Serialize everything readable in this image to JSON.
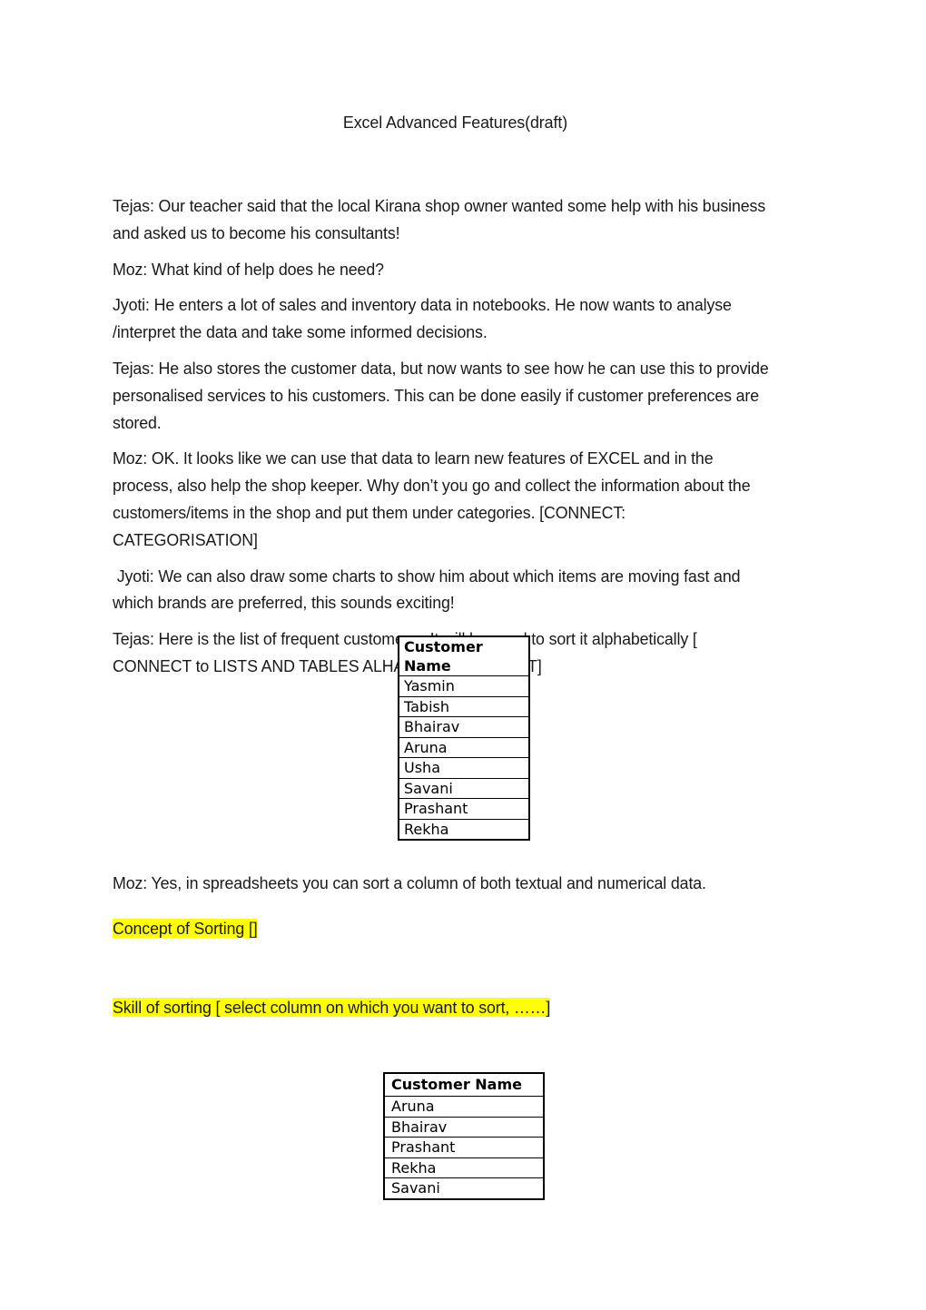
{
  "document": {
    "title": "Excel Advanced Features(draft)",
    "paragraphs": [
      {
        "id": "p-tejas-1",
        "speaker": "Tejas",
        "text": "Tejas: Our teacher said that the local Kirana shop owner wanted some help with his business and asked us to become his consultants!"
      },
      {
        "id": "p-moz-1",
        "speaker": "Moz",
        "text": "Moz: What kind of help does he need?"
      },
      {
        "id": "p-jyoti-1",
        "speaker": "Jyoti",
        "text": "Jyoti: He enters a lot of sales and inventory data in notebooks. He now wants to analyse /interpret the data and take some informed decisions."
      },
      {
        "id": "p-tejas-2",
        "speaker": "Tejas",
        "text": "Tejas: He also stores the customer data, but now wants to see how he can use this to provide personalised services to his customers. This can be done easily if customer preferences are stored."
      },
      {
        "id": "p-moz-2",
        "speaker": "Moz",
        "text": "Moz: OK. It looks like we can use that data to learn new features of EXCEL and in the process, also help the shop keeper. Why don’t you go and collect the information about the customers/items in the shop and put them under categories. [CONNECT: CATEGORISATION]"
      },
      {
        "id": "p-jyoti-2",
        "speaker": "Jyoti",
        "text": " Jyoti: We can also draw some charts to show him about which items are moving fast and which brands are preferred, this sounds exciting!"
      },
      {
        "id": "p-tejas-3",
        "speaker": "Tejas",
        "text": "Tejas: Here is the list of frequent customers.  It will be good to sort it alphabetically [ CONNECT to LISTS AND TABLES ALHABETICALLY SORT]"
      }
    ],
    "paragraph_after_table": {
      "id": "p-moz-3",
      "speaker": "Moz",
      "text": "Moz: Yes, in spreadsheets you can sort a column of both textual and numerical data."
    },
    "highlighted_lines": [
      {
        "id": "concept-of-sorting",
        "text": "Concept of Sorting []",
        "highlight_color": "#FFFF00"
      },
      {
        "id": "skill-of-sorting",
        "text": "Skill of sorting [ select column on which you want to sort, ……]",
        "highlight_color": "#FFFF00"
      }
    ],
    "tables": [
      {
        "id": "customer-unsorted",
        "header": "Customer Name",
        "rows": [
          "Yasmin",
          "Tabish",
          "Bhairav",
          "Aruna",
          "Usha",
          "Savani",
          "Prashant",
          "Rekha"
        ]
      },
      {
        "id": "customer-sorted",
        "header": "Customer Name",
        "rows": [
          "Aruna",
          "Bhairav",
          "Prashant",
          "Rekha",
          "Savani"
        ]
      }
    ]
  }
}
